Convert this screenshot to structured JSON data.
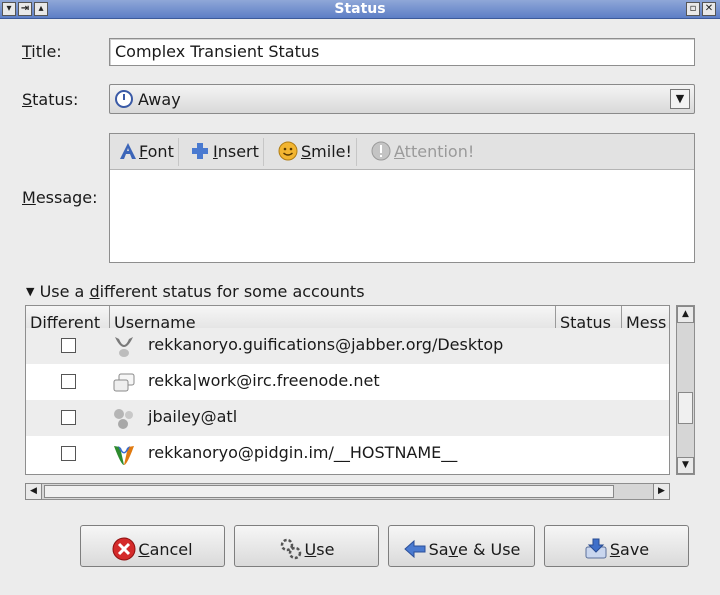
{
  "window": {
    "title": "Status"
  },
  "form": {
    "title_label": "itle:",
    "title_label_mnemonic": "T",
    "title_value": "Complex Transient Status",
    "status_label_mnemonic": "S",
    "status_label": "tatus:",
    "status_value": "Away",
    "message_label_mnemonic": "M",
    "message_label": "essage:"
  },
  "toolbar": {
    "font_mn": "F",
    "font": "ont",
    "insert_mn": "I",
    "insert": "nsert",
    "smile_mn": "S",
    "smile": "mile!",
    "attention_mn": "A",
    "attention": "ttention!"
  },
  "accounts": {
    "expander_pre": "Use a ",
    "expander_mn": "d",
    "expander_post": "ifferent status for some accounts",
    "columns": {
      "different": "Different",
      "username": "Username",
      "status": "Status",
      "message": "Mess"
    },
    "rows": [
      {
        "username": "rekkanoryo.guifications@jabber.org/Desktop"
      },
      {
        "username": "rekka|work@irc.freenode.net"
      },
      {
        "username": "jbailey@atl"
      },
      {
        "username": "rekkanoryo@pidgin.im/__HOSTNAME__"
      }
    ]
  },
  "buttons": {
    "cancel_mn": "C",
    "cancel": "ancel",
    "use_mn": "U",
    "use": "se",
    "saveuse_pre": "Sa",
    "saveuse_mn": "v",
    "saveuse_post": "e & Use",
    "save_mn": "S",
    "save": "ave"
  },
  "colors": {
    "titlebar": "#5d7ec6",
    "cancel_icon": "#d42a2a",
    "smile_icon": "#f2b531"
  }
}
